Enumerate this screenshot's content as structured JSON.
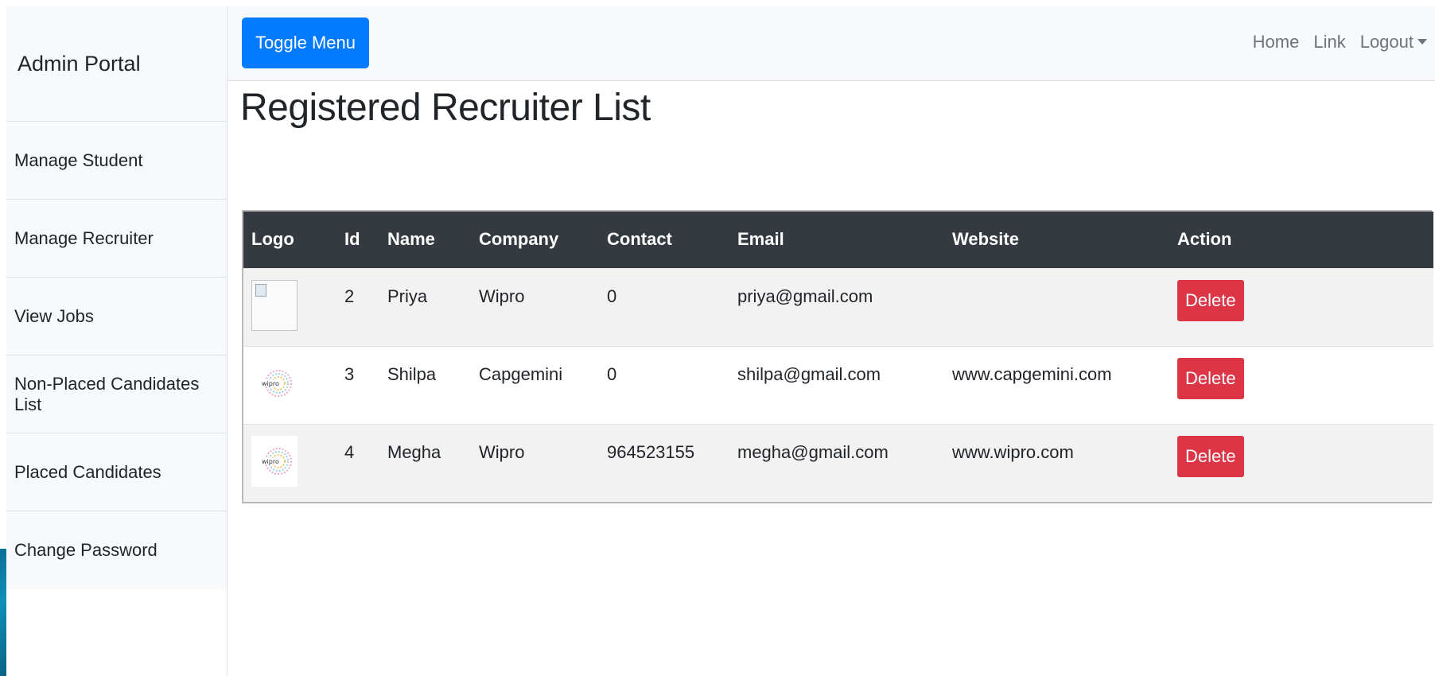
{
  "sidebar": {
    "heading": "Admin Portal",
    "items": [
      {
        "label": "Manage Student"
      },
      {
        "label": "Manage Recruiter"
      },
      {
        "label": "View Jobs"
      },
      {
        "label": "Non-Placed Candidates List"
      },
      {
        "label": "Placed Candidates"
      },
      {
        "label": "Change Password"
      }
    ]
  },
  "topbar": {
    "toggle_label": "Toggle Menu",
    "nav": {
      "home": "Home",
      "link": "Link",
      "logout": "Logout"
    }
  },
  "main": {
    "title": "Registered Recruiter List",
    "table": {
      "columns": [
        "Logo",
        "Id",
        "Name",
        "Company",
        "Contact",
        "Email",
        "Website",
        "Action"
      ],
      "rows": [
        {
          "logo": "broken-image-icon",
          "id": "2",
          "name": "Priya",
          "company": "Wipro",
          "contact": "0",
          "email": "priya@gmail.com",
          "website": "",
          "action": "Delete"
        },
        {
          "logo": "wipro-logo-icon",
          "id": "3",
          "name": "Shilpa",
          "company": "Capgemini",
          "contact": "0",
          "email": "shilpa@gmail.com",
          "website": "www.capgemini.com",
          "action": "Delete"
        },
        {
          "logo": "wipro-logo-icon",
          "id": "4",
          "name": "Megha",
          "company": "Wipro",
          "contact": "964523155",
          "email": "megha@gmail.com",
          "website": "www.wipro.com",
          "action": "Delete"
        }
      ]
    }
  },
  "colors": {
    "primary": "#007bff",
    "danger": "#dc3545",
    "table_header": "#343a40",
    "sidebar_bg": "#f8f9fa"
  }
}
